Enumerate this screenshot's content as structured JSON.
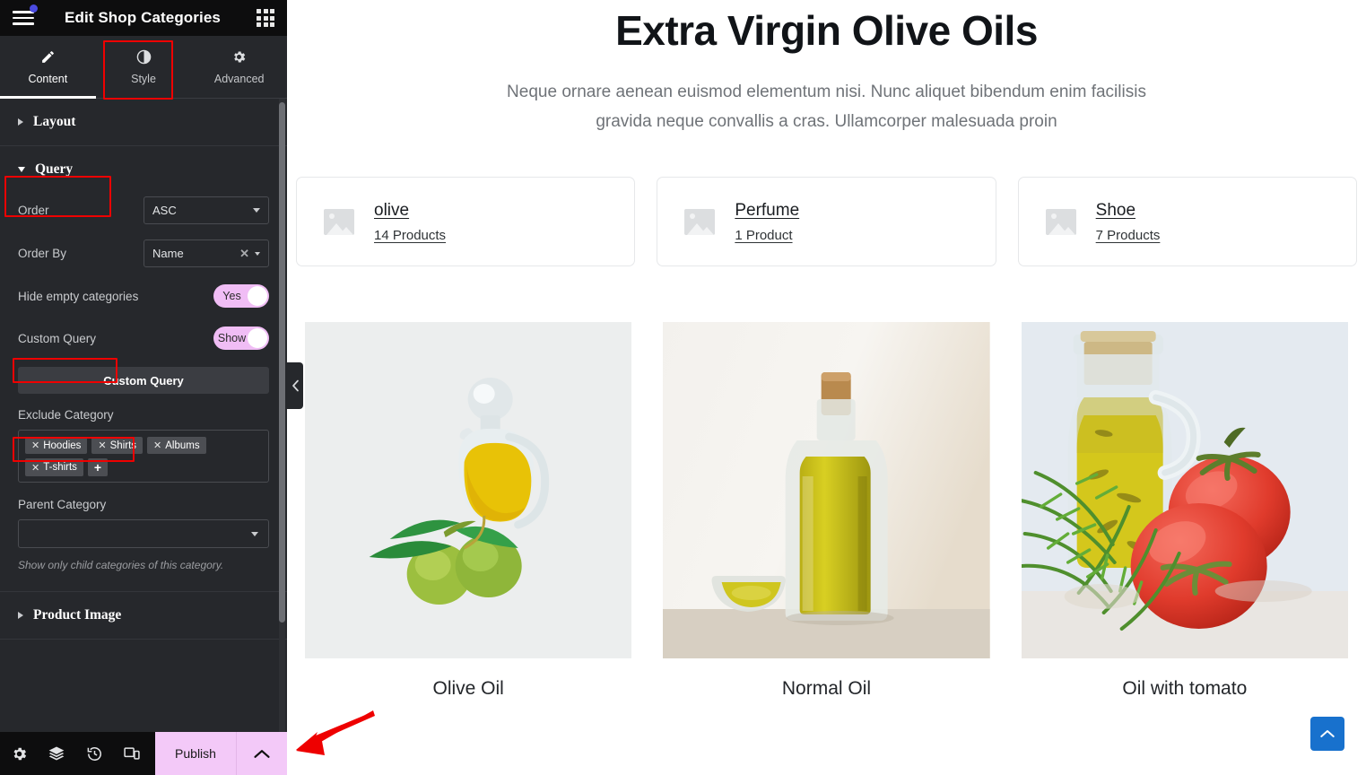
{
  "panel": {
    "title": "Edit Shop Categories",
    "menu_icon": "hamburger-icon",
    "apps_icon": "grid-apps-icon",
    "tabs": [
      {
        "label": "Content",
        "icon": "pencil-icon",
        "active": true
      },
      {
        "label": "Style",
        "icon": "contrast-circle-icon",
        "active": false
      },
      {
        "label": "Advanced",
        "icon": "gear-icon",
        "active": false
      }
    ],
    "sections": [
      {
        "label": "Layout",
        "expanded": false
      },
      {
        "label": "Query",
        "expanded": true
      },
      {
        "label": "Product Image",
        "expanded": false
      }
    ],
    "query": {
      "order_label": "Order",
      "order_value": "ASC",
      "order_by_label": "Order By",
      "order_by_value": "Name",
      "hide_empty_label": "Hide empty categories",
      "hide_empty_value": "Yes",
      "custom_query_label": "Custom Query",
      "custom_query_value": "Show",
      "custom_query_button": "Custom Query",
      "exclude_category_label": "Exclude Category",
      "exclude_tags": [
        "Hoodies",
        "Shirts",
        "Albums",
        "T-shirts"
      ],
      "add_tag_label": "+",
      "parent_category_label": "Parent Category",
      "parent_category_value": "",
      "parent_category_hint": "Show only child categories of this category."
    },
    "footer": {
      "icons": [
        "gear-icon",
        "layers-icon",
        "history-icon",
        "responsive-icon",
        "preview-eye-icon"
      ],
      "publish_label": "Publish",
      "publish_caret_icon": "chevron-up-icon"
    },
    "collapse_icon": "chevron-left-icon"
  },
  "canvas": {
    "hero": {
      "title": "Extra Virgin Olive Oils",
      "subtitle": "Neque ornare aenean euismod elementum nisi. Nunc aliquet bibendum enim facilisis gravida neque convallis a cras. Ullamcorper malesuada proin"
    },
    "categories": [
      {
        "name": "olive",
        "count": "14 Products",
        "image": "placeholder-image-icon"
      },
      {
        "name": "Perfume",
        "count": "1 Product",
        "image": "placeholder-image-icon"
      },
      {
        "name": "Shoe",
        "count": "7 Products",
        "image": "placeholder-image-icon"
      }
    ],
    "products": [
      {
        "title": "Olive Oil",
        "image": "olive-oil-carafe-with-olives-photo"
      },
      {
        "title": "Normal Oil",
        "image": "olive-oil-bottle-with-bowl-photo"
      },
      {
        "title": "Oil with tomato",
        "image": "oil-carafe-with-rosemary-and-tomatoes-photo"
      }
    ],
    "scroll_top_icon": "chevron-up-icon"
  },
  "annotations": {
    "color": "#ef0000",
    "boxes": [
      "style-tab",
      "query-section",
      "custom-query-label",
      "exclude-category-label"
    ],
    "arrow": "arrow-pointing-to-publish-button"
  }
}
